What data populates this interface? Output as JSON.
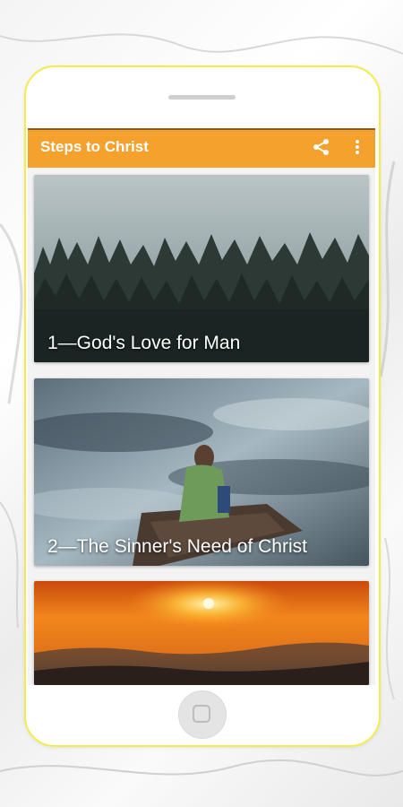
{
  "app": {
    "title": "Steps to Christ"
  },
  "toolbar": {
    "share_icon": "share-icon",
    "more_icon": "more-vertical-icon"
  },
  "chapters": [
    {
      "title": "1—God's Love for Man"
    },
    {
      "title": "2—The Sinner's Need of Christ"
    },
    {
      "title": ""
    }
  ],
  "colors": {
    "appbar": "#f5a12d",
    "phone_border": "#f4ec4c"
  }
}
